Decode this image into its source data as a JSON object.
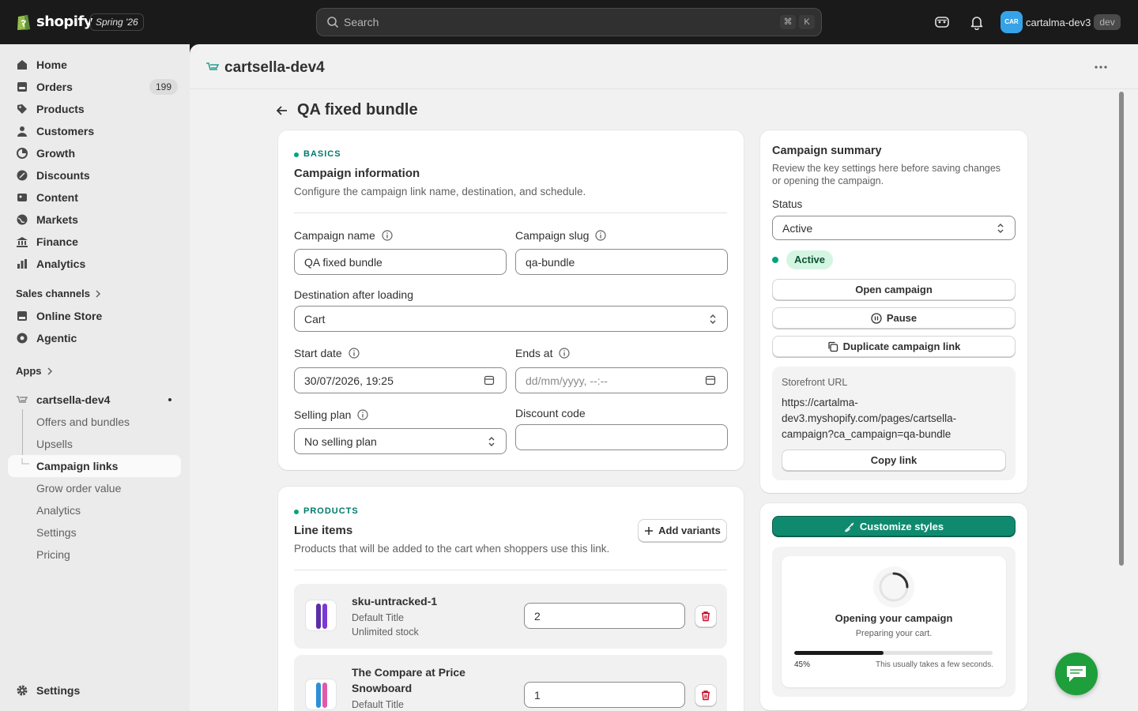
{
  "topbar": {
    "logo_text": "shopify",
    "edition": "Spring '26",
    "search_placeholder": "Search",
    "shortcut_cmd": "⌘",
    "shortcut_key": "K",
    "account_initials": "CAR",
    "account_name": "cartalma-dev3",
    "account_badge": "dev"
  },
  "sidebar": {
    "items": [
      {
        "label": "Home",
        "icon": "home-icon"
      },
      {
        "label": "Orders",
        "icon": "orders-icon",
        "count": "199"
      },
      {
        "label": "Products",
        "icon": "tag-icon"
      },
      {
        "label": "Customers",
        "icon": "person-icon"
      },
      {
        "label": "Growth",
        "icon": "growth-icon"
      },
      {
        "label": "Discounts",
        "icon": "discount-icon"
      },
      {
        "label": "Content",
        "icon": "content-icon"
      },
      {
        "label": "Markets",
        "icon": "globe-icon"
      },
      {
        "label": "Finance",
        "icon": "bank-icon"
      },
      {
        "label": "Analytics",
        "icon": "chart-icon"
      }
    ],
    "sales_channels_label": "Sales channels",
    "channels": [
      {
        "label": "Online Store",
        "icon": "store-icon"
      },
      {
        "label": "Agentic",
        "icon": "agentic-icon"
      }
    ],
    "apps_label": "Apps",
    "app_name": "cartsella-dev4",
    "app_subitems": [
      "Offers and bundles",
      "Upsells",
      "Campaign links",
      "Grow order value",
      "Analytics",
      "Settings",
      "Pricing"
    ],
    "settings_label": "Settings"
  },
  "app_header": {
    "title": "cartsella-dev4"
  },
  "page": {
    "title": "QA fixed bundle"
  },
  "basics": {
    "eyebrow": "BASICS",
    "title": "Campaign information",
    "subtitle": "Configure the campaign link name, destination, and schedule.",
    "campaign_name_label": "Campaign name",
    "campaign_name_value": "QA fixed bundle",
    "campaign_slug_label": "Campaign slug",
    "campaign_slug_value": "qa-bundle",
    "destination_label": "Destination after loading",
    "destination_value": "Cart",
    "start_date_label": "Start date",
    "start_date_value": "30/07/2026, 19:25",
    "ends_at_label": "Ends at",
    "ends_at_placeholder": "dd/mm/yyyy, --:--",
    "selling_plan_label": "Selling plan",
    "selling_plan_value": "No selling plan",
    "discount_code_label": "Discount code",
    "discount_code_value": ""
  },
  "products": {
    "eyebrow": "PRODUCTS",
    "title": "Line items",
    "subtitle": "Products that will be added to the cart when shoppers use this link.",
    "add_variants_label": "Add variants",
    "items": [
      {
        "title": "sku-untracked-1",
        "variant": "Default Title",
        "stock": "Unlimited stock",
        "quantity": "2"
      },
      {
        "title_line1": "The Compare at Price",
        "title_line2": "Snowboard",
        "variant": "Default Title",
        "quantity": "1"
      }
    ]
  },
  "summary": {
    "title": "Campaign summary",
    "description_line1": "Review the key settings here before saving changes",
    "description_line2": "or opening the campaign.",
    "status_label": "Status",
    "status_value": "Active",
    "status_badge": "Active",
    "open_label": "Open campaign",
    "pause_label": "Pause",
    "duplicate_label": "Duplicate campaign link",
    "storefront_label": "Storefront URL",
    "url_line1": "https://cartalma-",
    "url_line2": "dev3.myshopify.com/pages/cartsella-",
    "url_line3": "campaign?ca_campaign=qa-bundle",
    "copy_label": "Copy link"
  },
  "styles_card": {
    "customize_label": "Customize styles",
    "preview_title": "Opening your campaign",
    "preview_subtitle": "Preparing your cart.",
    "progress_percent": 45,
    "progress_label": "45%",
    "progress_note": "This usually takes a few seconds."
  },
  "colors": {
    "accent": "#108a6f",
    "status_green": "#00a47c",
    "chat": "#1f9e3c"
  }
}
